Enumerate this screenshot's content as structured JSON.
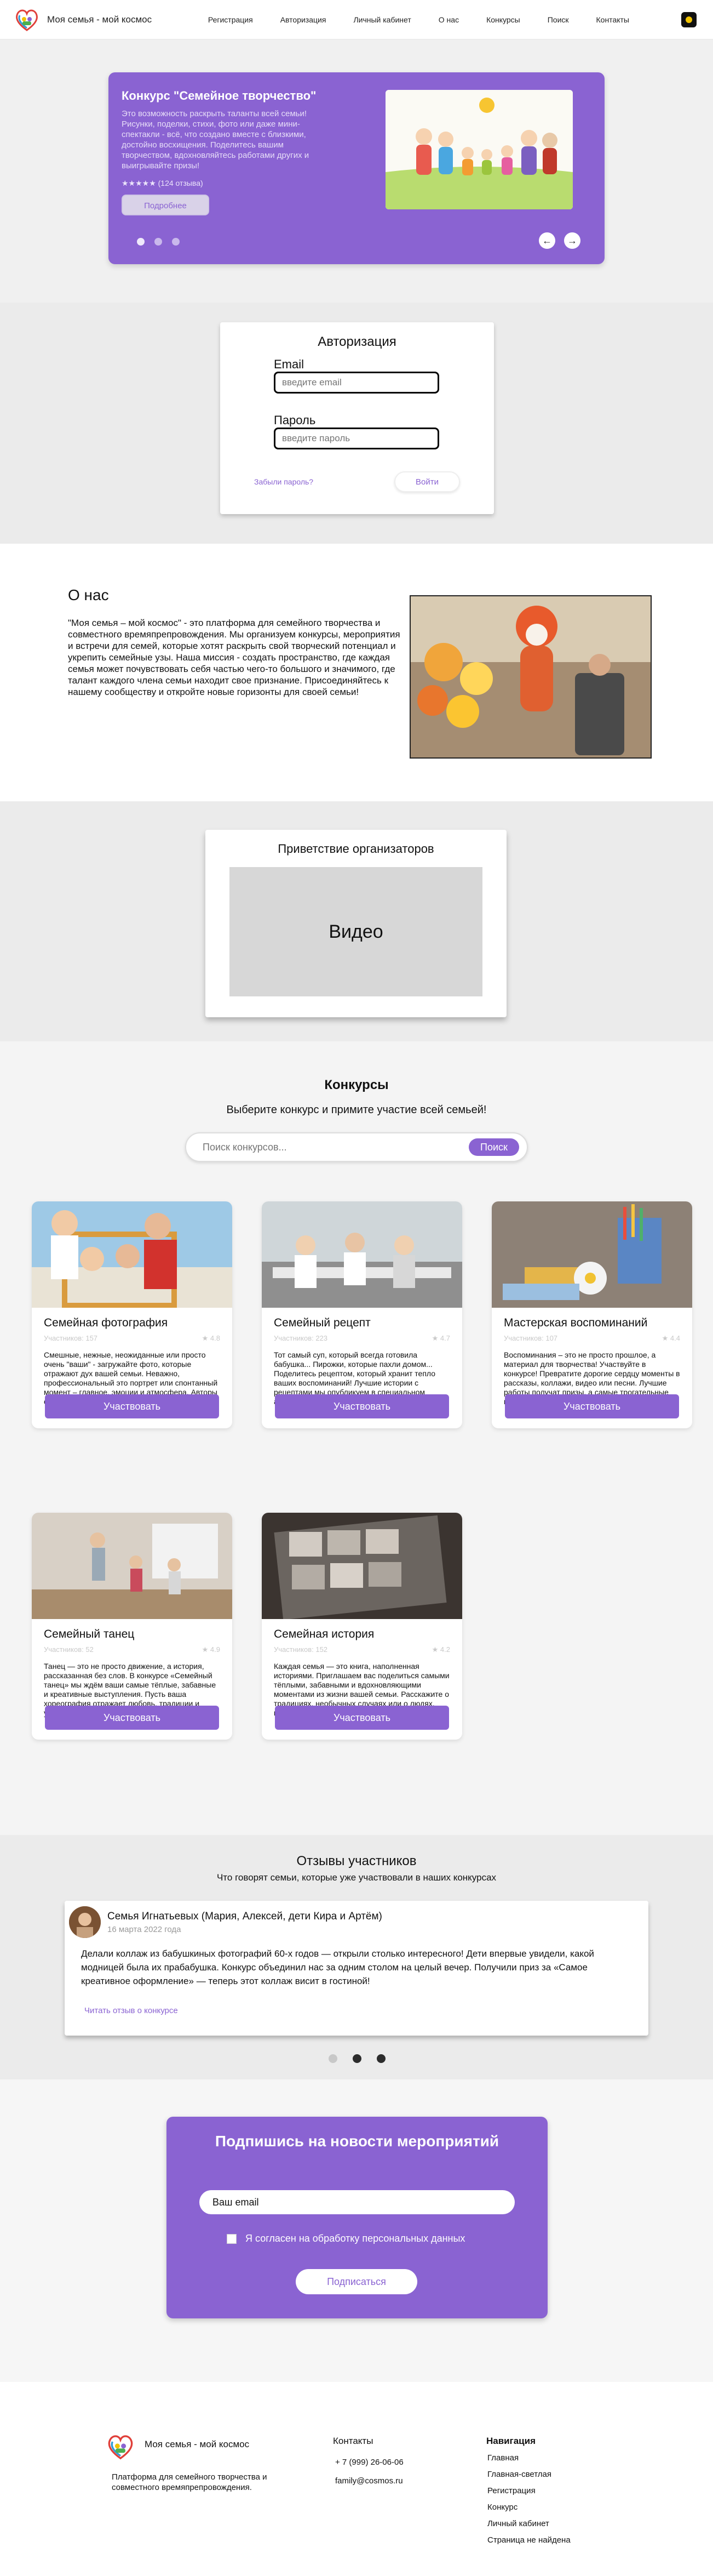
{
  "header": {
    "brand": "Моя семья - мой космос",
    "nav": [
      "Регистрация",
      "Авторизация",
      "Личный кабинет",
      "О нас",
      "Конкурсы",
      "Поиск",
      "Контакты"
    ]
  },
  "hero": {
    "title": "Конкурс \"Семейное творчество\"",
    "text": "Это возможность раскрыть таланты всей семьи! Рисунки, поделки, стихи, фото или даже мини-спектакли - всё, что создано вместе с близкими, достойно восхищения. Поделитесь вашим творчеством, вдохновляйтесь работами других и выигрывайте призы!",
    "rating": "★★★★★ (124 отзыва)",
    "button": "Подробнее"
  },
  "auth": {
    "title": "Авторизация",
    "email_label": "Email",
    "email_placeholder": "введите email",
    "password_label": "Пароль",
    "password_placeholder": "введите пароль",
    "forgot": "Забыли пароль?",
    "login": "Войти"
  },
  "about": {
    "title": "О нас",
    "text": "\"Моя семья – мой космос\" - это платформа для семейного творчества и совместного времяпрепровождения. Мы организуем конкурсы, мероприятия и встречи для семей, которые хотят раскрыть свой творческий потенциал и укрепить семейные узы. Наша миссия - создать пространство, где каждая семья может почувствовать себя частью чего-то большого и значимого, где талант каждого члена семьи находит свое признание. Присоединяйтесь к нашему сообществу и откройте новые горизонты для своей семьи!"
  },
  "video": {
    "title": "Приветствие организаторов",
    "placeholder": "Видео"
  },
  "contests": {
    "title": "Конкурсы",
    "subtitle": "Выберите конкурс и примите участие всей семьей!",
    "search_placeholder": "Поиск конкурсов...",
    "search_button": "Поиск",
    "cards": [
      {
        "title": "Семейная фотография",
        "participants": "Участников: 157",
        "rating": "★ 4.8",
        "desc": "Смешные, нежные, неожиданные или просто очень \"ваши\" - загружайте фото, которые отражают дух вашей семьи. Неважно, профессиональный это портрет или спонтанный момент – главное, эмоции и атмосфера. Авторы самых ярких работ получат крутые призы!",
        "button": "Участвовать"
      },
      {
        "title": "Семейный рецепт",
        "participants": "Участников: 223",
        "rating": "★ 4.7",
        "desc": "Тот самый суп, который всегда готовила бабушка... Пирожки, которые пахли домом... Поделитесь рецептом, который хранит тепло ваших воспоминаний! Лучшие истории с рецептами мы опубликуем в специальном альбоме семейных кулинарных традиций",
        "button": "Участвовать"
      },
      {
        "title": "Мастерская воспоминаний",
        "participants": "Участников: 107",
        "rating": "★ 4.4",
        "desc": "Воспоминания – это не просто прошлое, а материал для творчества! Участвуйте в конкурсе! Превратите дорогие сердцу моменты в рассказы, коллажи, видео или песни. Лучшие работы получат призы, а самые трогательные истории войдут в общий альбом памяти!",
        "button": "Участвовать"
      },
      {
        "title": "Семейный танец",
        "participants": "Участников: 52",
        "rating": "★ 4.9",
        "desc": "Танец — это не просто движение, а история, рассказанная без слов. В конкурсе «Семейный танец» мы ждём ваши самые тёплые, забавные и креативные выступления. Пусть ваша хореография отражает любовь, традиции и уникальный характер вашей семьи!",
        "button": "Участвовать"
      },
      {
        "title": "Семейная история",
        "participants": "Участников: 152",
        "rating": "★ 4.2",
        "desc": "Каждая семья — это книга, наполненная историями. Приглашаем вас поделиться самыми тёплыми, забавными и вдохновляющими моментами из жизни вашей семьи. Расскажите о традициях, необычных случаях или о людях, которые сделали вашу историю уникальной!",
        "button": "Участвовать"
      }
    ]
  },
  "reviews": {
    "title": "Отзывы участников",
    "subtitle": "Что говорят семьи, которые уже участвовали в наших конкурсах",
    "name": "Семья Игнатьевых (Мария, Алексей, дети Кира и Артём)",
    "date": "16 марта 2022 года",
    "text": "Делали коллаж из бабушкиных фотографий 60-х годов — открыли столько интересного! Дети впервые увидели, какой модницей была их прабабушка. Конкурс объединил нас за одним столом на целый вечер. Получили приз за «Самое креативное оформление» — теперь этот коллаж висит в гостиной!",
    "link": "Читать отзыв о конкурсе"
  },
  "subscribe": {
    "title": "Подпишись на новости мероприятий",
    "email_value": "Ваш email",
    "consent": "Я согласен на обработку персональных данных",
    "button": "Подписаться"
  },
  "footer": {
    "brand": "Моя семья - мой космос",
    "desc": "Платформа для семейного творчества и совместного времяпрепровождения.",
    "contacts_title": "Контакты",
    "phone": "+ 7 (999) 26-06-06",
    "email": "family@cosmos.ru",
    "nav_title": "Навигация",
    "nav": [
      "Главная",
      "Главная-светлая",
      "Регистрация",
      "Конкурс",
      "Личный кабинет",
      "Страница не найдена"
    ]
  },
  "colors": {
    "accent": "#8a63d2"
  }
}
